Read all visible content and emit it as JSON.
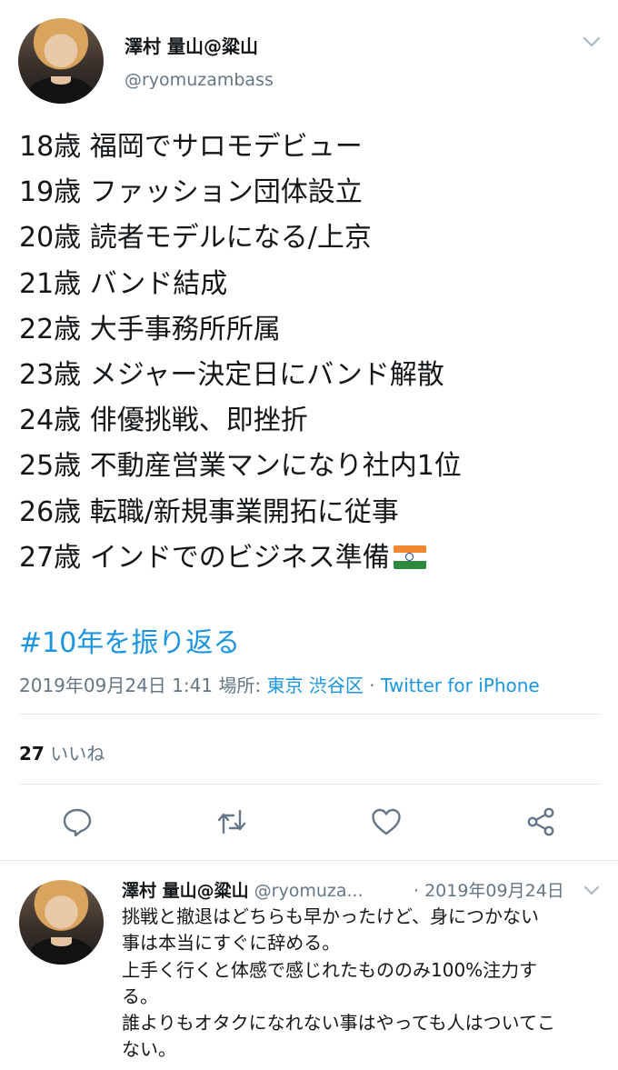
{
  "tweet": {
    "author_name": "澤村 量山@粱山",
    "author_handle": "@ryomuzambass",
    "lines": [
      "18歳 福岡でサロモデビュー",
      "19歳 ファッション団体設立",
      "20歳 読者モデルになる/上京",
      "21歳 バンド結成",
      "22歳 大手事務所所属",
      "23歳 メジャー決定日にバンド解散",
      "24歳 俳優挑戦、即挫折",
      "25歳 不動産営業マンになり社内1位",
      "26歳 転職/新規事業開拓に従事",
      "27歳 インドでのビジネス準備"
    ],
    "flag_icon": "india-flag-emoji",
    "hashtag": "#10年を振り返る",
    "timestamp": "2019年09月24日 1:41",
    "location_label": "場所:",
    "location": "東京 渋谷区",
    "separator": "·",
    "source": "Twitter for iPhone",
    "like_count": "27",
    "like_label": "いいね"
  },
  "actions": {
    "reply_icon": "reply-bubble-icon",
    "retweet_icon": "retweet-icon",
    "like_icon": "heart-icon",
    "share_icon": "share-icon",
    "icon_color": "#657786"
  },
  "reply": {
    "author_name": "澤村 量山@粱山",
    "author_handle": "@ryomuza...",
    "date": "· 2019年09月24日",
    "lines": [
      "挑戦と撤退はどちらも早かったけど、身につかない",
      "事は本当にすぐに辞める。",
      "上手く行くと体感で感じれたもののみ100%注力す",
      "る。",
      "誰よりもオタクになれない事はやっても人はついてこ",
      "ない。"
    ]
  },
  "colors": {
    "link": "#1b95e0",
    "secondary_text": "#657786",
    "primary_text": "#14171a",
    "divider": "#e1e8ed"
  }
}
